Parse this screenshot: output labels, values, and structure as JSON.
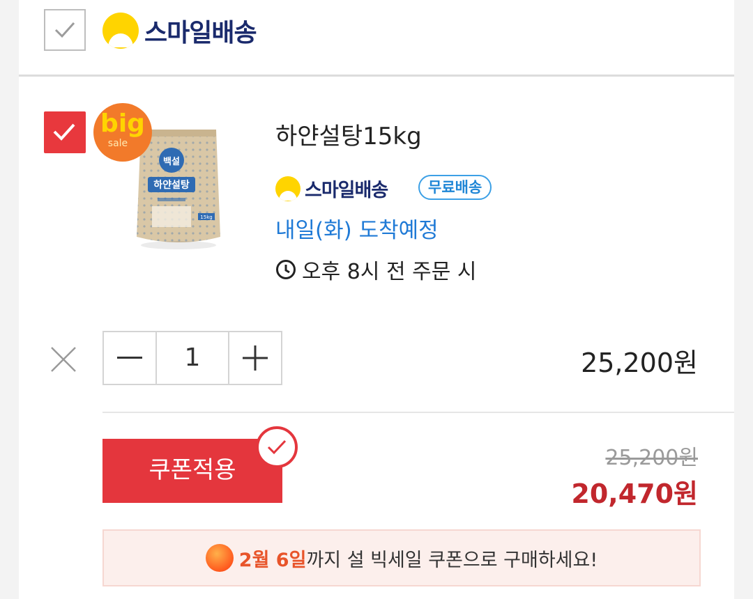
{
  "header": {
    "brand": "스마일배송",
    "checked": false
  },
  "product": {
    "checked": true,
    "badge_top": "big",
    "badge_bottom": "sale",
    "bag_brand": "백설",
    "bag_label": "하얀설탕",
    "bag_weight": "15kg",
    "name": "하얀설탕15kg",
    "delivery_brand": "스마일배송",
    "free_shipping": "무료배송",
    "arrival": "내일(화) 도착예정",
    "order_time": "오후 8시 전 주문 시"
  },
  "quantity": {
    "value": "1",
    "minus": "−",
    "plus": "+"
  },
  "price": "25,200원",
  "coupon": {
    "button": "쿠폰적용",
    "original_price": "25,200원",
    "sale_price": "20,470원"
  },
  "notice": {
    "date": "2월 6일",
    "text": "까지 설 빅세일 쿠폰으로 구매하세요!"
  },
  "colors": {
    "accent": "#e4363d",
    "link": "#1f7ad6",
    "brand_yellow": "#ffd400",
    "brand_navy": "#1a2a6c"
  }
}
